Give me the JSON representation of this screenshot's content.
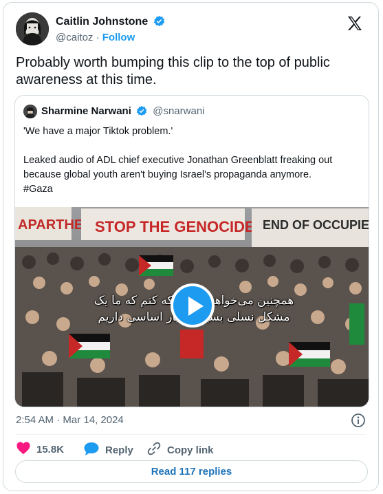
{
  "author": {
    "name": "Caitlin Johnstone",
    "handle": "@caitoz",
    "separator": "·",
    "follow_label": "Follow",
    "verified": true
  },
  "platform_icon": "x-logo-icon",
  "tweet": {
    "text": "Probably worth bumping this clip to the top of public awareness at this time."
  },
  "quoted": {
    "name": "Sharmine Narwani",
    "handle": "@snarwani",
    "verified": true,
    "line1": "'We have a major Tiktok problem.'",
    "line2": "Leaked audio of ADL chief executive Jonathan Greenblatt freaking out because global youth aren't buying Israel's propaganda anymore.",
    "hashtag": "#Gaza",
    "video": {
      "banner_left": "APARTHEID",
      "banner_center": "STOP THE GENOCIDE",
      "banner_right": "END OF OCCUPIED",
      "subtitle_line1": "همچنین می‌خواهم بگویم که کتم که ما یک",
      "subtitle_line2": "مشکل نسلی بسیار بسیار اساسی داریم"
    }
  },
  "timestamp": "2:54 AM · Mar 14, 2024",
  "actions": {
    "likes": "15.8K",
    "reply_label": "Reply",
    "copy_label": "Copy link"
  },
  "read_replies_label": "Read 117 replies",
  "colors": {
    "accent": "#1d9bf0",
    "heart": "#f91880",
    "muted": "#536471"
  }
}
